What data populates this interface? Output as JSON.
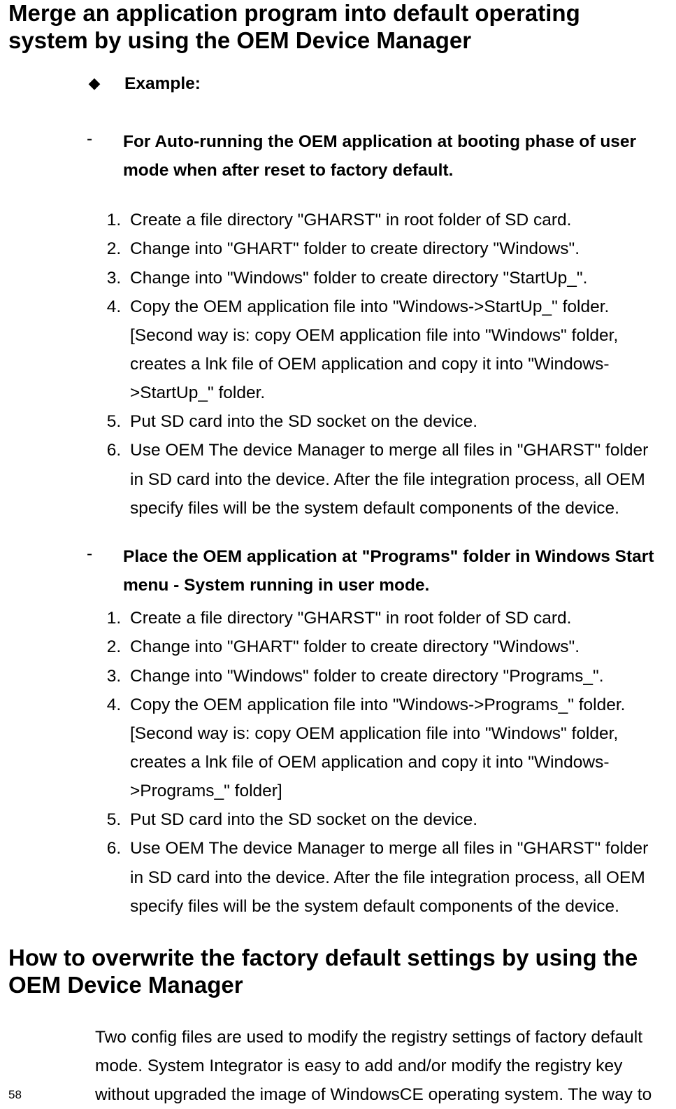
{
  "heading1": "Merge an application program into default operating system by using the OEM Device Manager",
  "bullet": {
    "marker": "◆",
    "label": "Example:"
  },
  "sectionA": {
    "dash": "-",
    "text": "For Auto-running the OEM application at booting phase of user mode when after reset to factory default.",
    "steps": [
      "Create a file directory \"GHARST\" in root folder of SD card.",
      "Change into \"GHART\" folder to create directory \"Windows\".",
      "Change into \"Windows\" folder to create directory \"StartUp_\".",
      "Copy the OEM application file into \"Windows->StartUp_\" folder. [Second way is: copy OEM application file into \"Windows\" folder, creates a lnk file of OEM application and copy it into \"Windows->StartUp_\" folder.",
      "Put SD card into the SD socket on the device.",
      "Use OEM The device Manager to merge all files in \"GHARST\" folder in SD card into the device. After the file integration process, all OEM specify files will be the system default components of the device."
    ]
  },
  "sectionB": {
    "dash": "-",
    "text": "Place the OEM application at \"Programs\" folder in Windows Start menu - System running in user mode.",
    "steps": [
      "Create a file directory \"GHARST\" in root folder of SD card.",
      "Change into \"GHART\" folder to create directory \"Windows\".",
      "Change into \"Windows\" folder to create directory \"Programs_\".",
      "Copy the OEM application file into \"Windows->Programs_\" folder. [Second way is: copy OEM application file into \"Windows\" folder, creates a lnk file of OEM application and copy it into \"Windows->Programs_\" folder]",
      "Put SD card into the SD socket on the device.",
      "Use OEM The device Manager to merge all files in \"GHARST\" folder in SD card into the device. After the file integration process, all OEM specify files will be the system default components of the device."
    ]
  },
  "heading2": "How to overwrite the factory default settings by using the OEM Device Manager",
  "para": "Two config files are used to modify the registry settings of factory default mode. System Integrator is easy to add and/or modify the registry key without upgraded the image of WindowsCE operating system. The way to",
  "pageNumber": "58"
}
